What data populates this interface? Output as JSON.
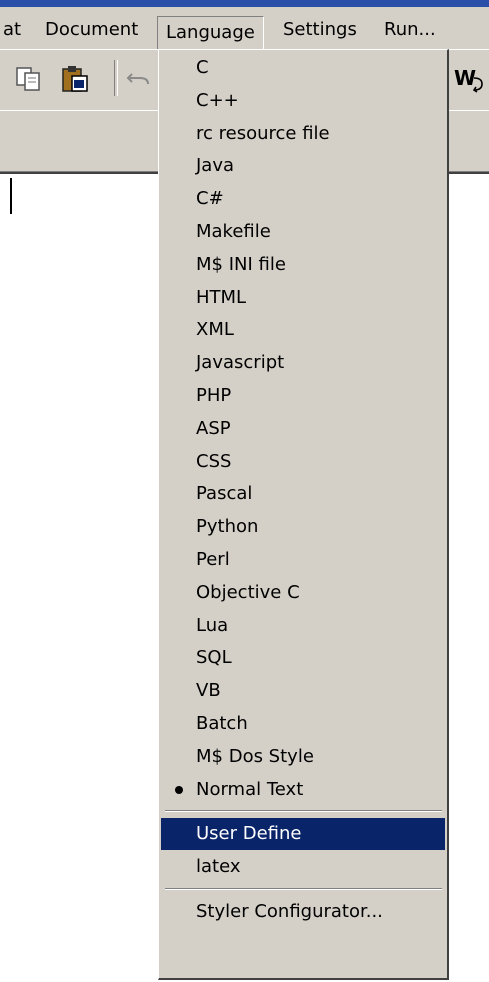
{
  "menubar": {
    "items": [
      "at",
      "Document",
      "Language",
      "Settings",
      "Run..."
    ],
    "open_menu": "Language"
  },
  "toolbar": {
    "icons": [
      "copy-icon",
      "paste-icon",
      "undo-icon",
      "wrap-icon"
    ],
    "wrap_glyph": "W"
  },
  "language_menu": {
    "items": [
      {
        "label": "C"
      },
      {
        "label": "C++"
      },
      {
        "label": "rc resource file"
      },
      {
        "label": "Java"
      },
      {
        "label": "C#"
      },
      {
        "label": "Makefile"
      },
      {
        "label": "M$ INI file"
      },
      {
        "label": "HTML"
      },
      {
        "label": "XML"
      },
      {
        "label": "Javascript"
      },
      {
        "label": "PHP"
      },
      {
        "label": "ASP"
      },
      {
        "label": "CSS"
      },
      {
        "label": "Pascal"
      },
      {
        "label": "Python"
      },
      {
        "label": "Perl"
      },
      {
        "label": "Objective C"
      },
      {
        "label": "Lua"
      },
      {
        "label": "SQL"
      },
      {
        "label": "VB"
      },
      {
        "label": "Batch"
      },
      {
        "label": "M$ Dos Style"
      },
      {
        "label": "Normal Text",
        "checked": true
      }
    ],
    "group2": [
      {
        "label": "User Define",
        "highlighted": true
      },
      {
        "label": "latex"
      }
    ],
    "group3": [
      {
        "label": "Styler Configurator..."
      }
    ]
  },
  "colors": {
    "menu_face": "#d4d0c8",
    "highlight": "#0a246a",
    "highlight_text": "#ffffff"
  }
}
